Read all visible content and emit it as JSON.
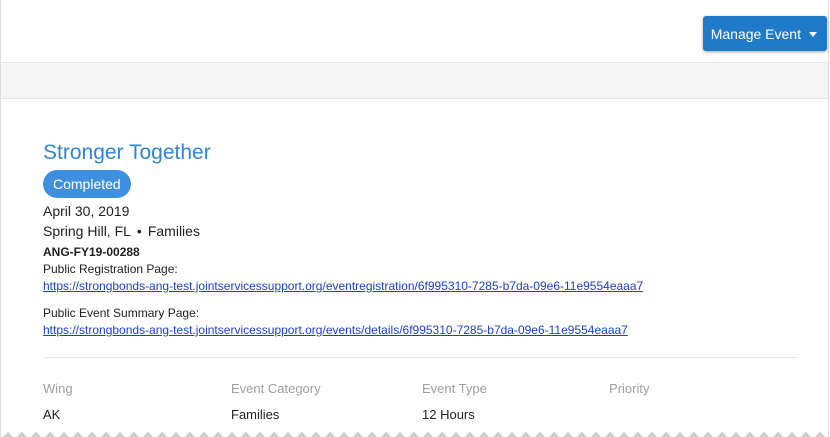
{
  "header": {
    "manage_event_label": "Manage Event"
  },
  "event": {
    "title": "Stronger Together",
    "status": "Completed",
    "date": "April 30, 2019",
    "location": "Spring Hill, FL",
    "separator": "•",
    "audience": "Families",
    "code": "ANG-FY19-00288",
    "public_registration_label": "Public Registration Page:",
    "public_registration_url": "https://strongbonds-ang-test.jointservicessupport.org/eventregistration/6f995310-7285-b7da-09e6-11e9554eaaa7",
    "public_summary_label": "Public Event Summary Page:",
    "public_summary_url": "https://strongbonds-ang-test.jointservicessupport.org/events/details/6f995310-7285-b7da-09e6-11e9554eaaa7"
  },
  "details": {
    "wing_label": "Wing",
    "wing_value": "AK",
    "category_label": "Event Category",
    "category_value": "Families",
    "type_label": "Event Type",
    "type_value": "12 Hours",
    "priority_label": "Priority",
    "priority_value": ""
  },
  "colors": {
    "primary_button": "#1f7ac9",
    "title": "#2f84d8",
    "badge": "#3f8fe0",
    "link": "#1a3fd1"
  }
}
